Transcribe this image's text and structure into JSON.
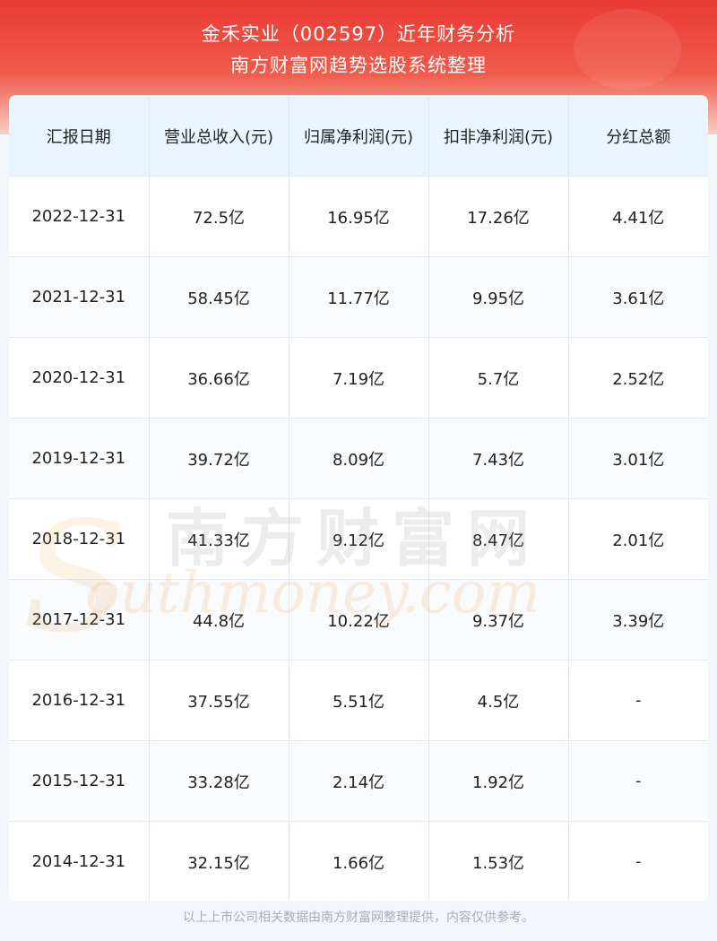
{
  "header": {
    "title_line1": "金禾实业（002597）近年财务分析",
    "title_line2": "南方财富网趋势选股系统整理"
  },
  "watermark": {
    "cn": "南方财富网",
    "en": "outhmoney.com",
    "s": "S"
  },
  "footer": {
    "text": "以上上市公司相关数据由南方财富网整理提供，内容仅供参考。"
  },
  "chart_data": {
    "type": "table",
    "columns": [
      "汇报日期",
      "营业总收入(元)",
      "归属净利润(元)",
      "扣非净利润(元)",
      "分红总额"
    ],
    "rows": [
      [
        "2022-12-31",
        "72.5亿",
        "16.95亿",
        "17.26亿",
        "4.41亿"
      ],
      [
        "2021-12-31",
        "58.45亿",
        "11.77亿",
        "9.95亿",
        "3.61亿"
      ],
      [
        "2020-12-31",
        "36.66亿",
        "7.19亿",
        "5.7亿",
        "2.52亿"
      ],
      [
        "2019-12-31",
        "39.72亿",
        "8.09亿",
        "7.43亿",
        "3.01亿"
      ],
      [
        "2018-12-31",
        "41.33亿",
        "9.12亿",
        "8.47亿",
        "2.01亿"
      ],
      [
        "2017-12-31",
        "44.8亿",
        "10.22亿",
        "9.37亿",
        "3.39亿"
      ],
      [
        "2016-12-31",
        "37.55亿",
        "5.51亿",
        "4.5亿",
        "-"
      ],
      [
        "2015-12-31",
        "33.28亿",
        "2.14亿",
        "1.92亿",
        "-"
      ],
      [
        "2014-12-31",
        "32.15亿",
        "1.66亿",
        "1.53亿",
        "-"
      ]
    ]
  }
}
